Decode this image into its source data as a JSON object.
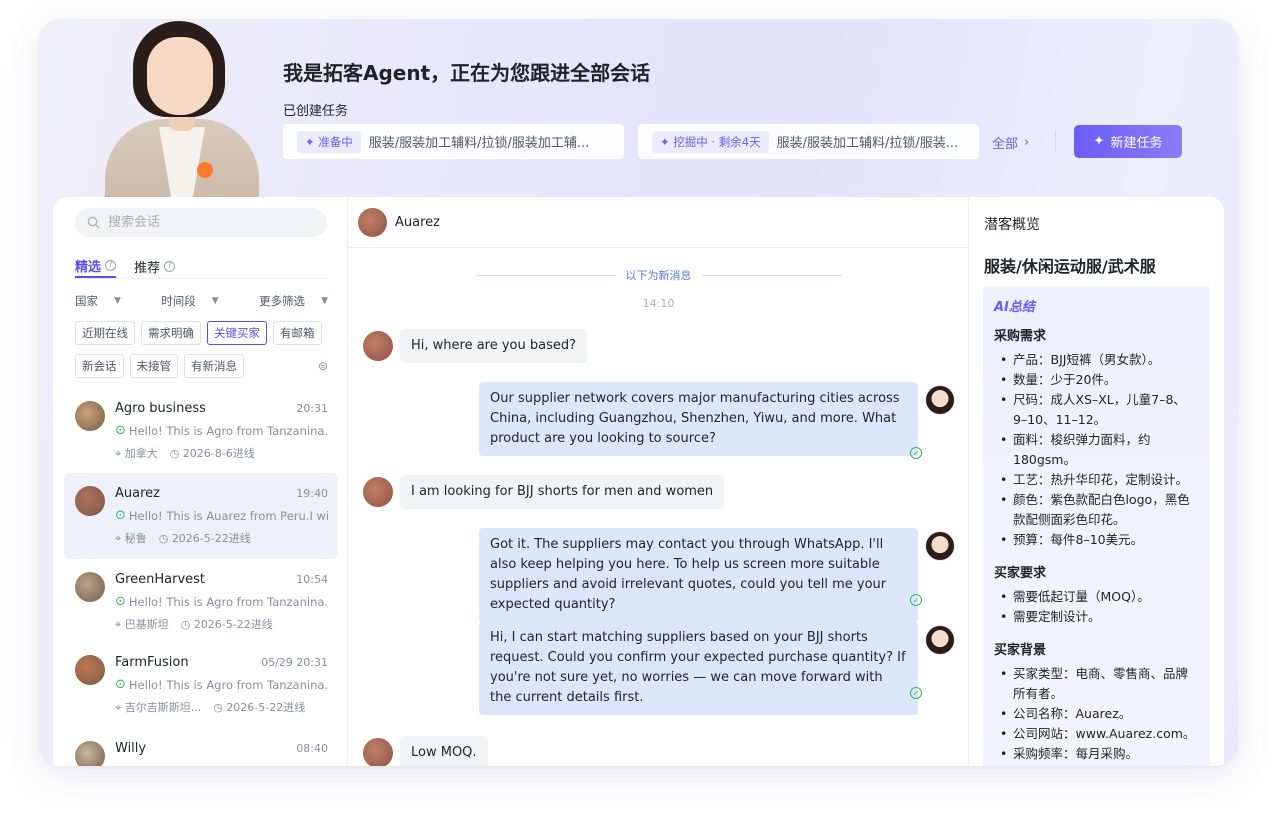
{
  "header": {
    "title": "我是拓客Agent，正在为您跟进全部会话",
    "subtitle": "已创建任务",
    "tasks": [
      {
        "status": "准备中",
        "text": "服装/服装加工辅料/拉锁/服装加工辅..."
      },
      {
        "status": "挖掘中 · 剩余4天",
        "text": "服装/服装加工辅料/拉锁/服装..."
      }
    ],
    "all_label": "全部",
    "new_task_label": "新建任务"
  },
  "sidebar": {
    "search_placeholder": "搜索会话",
    "tabs": [
      {
        "label": "精选",
        "active": true
      },
      {
        "label": "推荐",
        "active": false
      }
    ],
    "filters": [
      "国家",
      "时间段",
      "更多筛选"
    ],
    "chips_row1": [
      "近期在线",
      "需求明确",
      "关键买家",
      "有邮箱"
    ],
    "chips_row2": [
      "新会话",
      "未接管",
      "有新消息"
    ],
    "selected_chip": "关键买家",
    "conversations": [
      {
        "name": "Agro business",
        "time": "20:31",
        "preview": "Hello! This is Agro from Tanzanina.I ...",
        "country": "加拿大",
        "date": "2026-8-6进线",
        "color": "#c9a37a"
      },
      {
        "name": "Auarez",
        "time": "19:40",
        "preview": "Hello! This is Auarez from Peru.I wis...",
        "country": "秘鲁",
        "date": "2026-5-22进线",
        "color": "#b0705c",
        "selected": true
      },
      {
        "name": "GreenHarvest",
        "time": "10:54",
        "preview": "Hello! This is Agro from Tanzanina.I ...",
        "country": "巴基斯坦",
        "date": "2026-5-22进线",
        "color": "#b6a48c"
      },
      {
        "name": "FarmFusion",
        "time": "05/29 20:31",
        "preview": "Hello! This is Agro from Tanzanina.I ...",
        "country": "吉尔吉斯斯坦...",
        "date": "2026-5-22进线",
        "color": "#c0784e"
      },
      {
        "name": "Willy",
        "time": "08:40",
        "preview": "",
        "country": "",
        "date": "",
        "color": "#c8b7a2"
      }
    ]
  },
  "chat": {
    "contact": "Auarez",
    "new_messages_label": "以下为新消息",
    "timestamp": "14:10",
    "messages": [
      {
        "dir": "in",
        "text": "Hi, where are you based?"
      },
      {
        "dir": "out",
        "text": "Our supplier network covers major manufacturing cities across China, including Guangzhou, Shenzhen, Yiwu, and more. What product are you looking to source?"
      },
      {
        "dir": "in",
        "text": "I am looking for BJJ shorts for men and women"
      },
      {
        "dir": "out",
        "text": "Got it. The suppliers may contact you through WhatsApp. I'll also keep helping you here. To help us screen more suitable suppliers and avoid irrelevant quotes, could you tell me your expected quantity?"
      },
      {
        "dir": "out",
        "text": "Hi, I can start matching suppliers based on your BJJ shorts request. Could you confirm your expected purchase quantity? If you're not sure yet, no worries — we can move forward with the current details first."
      },
      {
        "dir": "in",
        "text": "Low MOQ."
      }
    ]
  },
  "overview": {
    "title": "潜客概览",
    "category": "服装/休闲运动服/武术服",
    "ai_label": "AI总结",
    "sections": [
      {
        "heading": "采购需求",
        "items": [
          "产品：BJJ短裤（男女款）。",
          "数量：少于20件。",
          "尺码：成人XS–XL，儿童7–8、9–10、11–12。",
          "面料：梭织弹力面料，约180gsm。",
          "工艺：热升华印花，定制设计。",
          "颜色：紫色款配白色logo，黑色款配侧面彩色印花。",
          "预算：每件8–10美元。"
        ]
      },
      {
        "heading": "买家要求",
        "items": [
          "需要低起订量（MOQ）。",
          "需要定制设计。"
        ]
      },
      {
        "heading": "买家背景",
        "items": [
          "买家类型：电商、零售商、品牌所有者。",
          "公司名称：Auarez。",
          "公司网站：www.Auarez.com。",
          "采购频率：每月采购。"
        ]
      }
    ]
  },
  "colors": {
    "accent": "#6a5cf0",
    "selected_bg": "#eef0fc",
    "outgoing_bubble": "#dbe6fb",
    "incoming_bubble": "#f2f3f5",
    "check": "#2fb85a"
  },
  "icons": [
    "search-icon",
    "question-icon",
    "caret-down-icon",
    "filter-settings-icon",
    "check-circle-icon",
    "location-icon",
    "clock-icon",
    "sparkle-icon",
    "chevron-right-icon"
  ]
}
